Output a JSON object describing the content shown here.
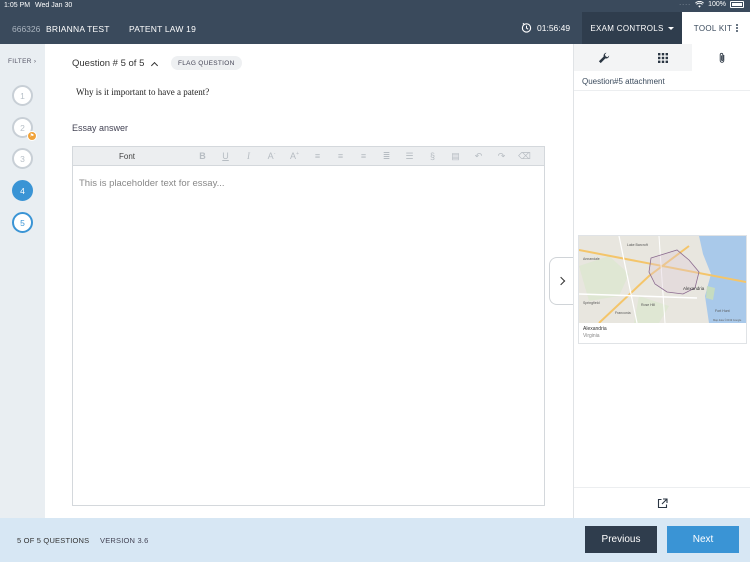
{
  "status": {
    "time": "1:05 PM",
    "date": "Wed Jan 30",
    "battery": "100%"
  },
  "header": {
    "student_id": "666326",
    "student_name": "BRIANNA TEST",
    "course": "PATENT LAW 19",
    "timer": "01:56:49",
    "exam_controls_label": "EXAM CONTROLS",
    "toolkit_label": "TOOL KIT"
  },
  "sidebar": {
    "filter_label": "FILTER",
    "questions": [
      {
        "number": "1",
        "state": "unanswered"
      },
      {
        "number": "2",
        "state": "flagged"
      },
      {
        "number": "3",
        "state": "unanswered"
      },
      {
        "number": "4",
        "state": "answered"
      },
      {
        "number": "5",
        "state": "current"
      }
    ]
  },
  "main": {
    "question_header": "Question # 5 of 5",
    "flag_label": "FLAG QUESTION",
    "question_text": "Why is it important to have a patent?",
    "essay_label": "Essay answer",
    "toolbar_font_label": "Font",
    "editor_placeholder": "This is placeholder text for essay..."
  },
  "right_panel": {
    "attachment_title": "Question#5 attachment",
    "map_caption_title": "Alexandria",
    "map_caption_sub": "Virginia",
    "map_labels": [
      "Alexandria",
      "Annandale",
      "Springfield",
      "Fort Hunt",
      "Lake Barcroft",
      "Franconia",
      "Rose Hill"
    ],
    "map_copyright": "Map data ©2019 Google"
  },
  "footer": {
    "question_count": "5 OF 5 QUESTIONS",
    "version": "VERSION 3.6",
    "previous_label": "Previous",
    "next_label": "Next"
  },
  "colors": {
    "header_bg": "#3a4a5c",
    "accent": "#3a94d5",
    "footer_bg": "#d7e7f4",
    "flag": "#f0a23a"
  }
}
